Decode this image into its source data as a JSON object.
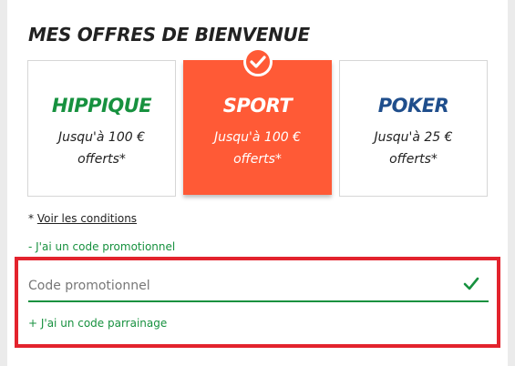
{
  "title": "MES OFFRES DE BIENVENUE",
  "offers": [
    {
      "name": "HIPPIQUE",
      "desc": "Jusqu'à 100 € offerts*"
    },
    {
      "name": "SPORT",
      "desc": "Jusqu'à 100 € offerts*",
      "selected": true
    },
    {
      "name": "POKER",
      "desc": "Jusqu'à 25 € offerts*"
    }
  ],
  "conditions": {
    "prefix": "* ",
    "link": "Voir les conditions"
  },
  "promo_toggle": "- J'ai un code promotionnel",
  "promo_field": {
    "placeholder": "Code promotionnel",
    "value": ""
  },
  "parrain_toggle": "+ J'ai un code parrainage",
  "icons": {
    "selected": "check-icon",
    "valid": "check-icon"
  },
  "colors": {
    "hippique": "#17913f",
    "sport": "#ff5a36",
    "poker": "#1f4e8c",
    "highlight": "#e3232d"
  }
}
